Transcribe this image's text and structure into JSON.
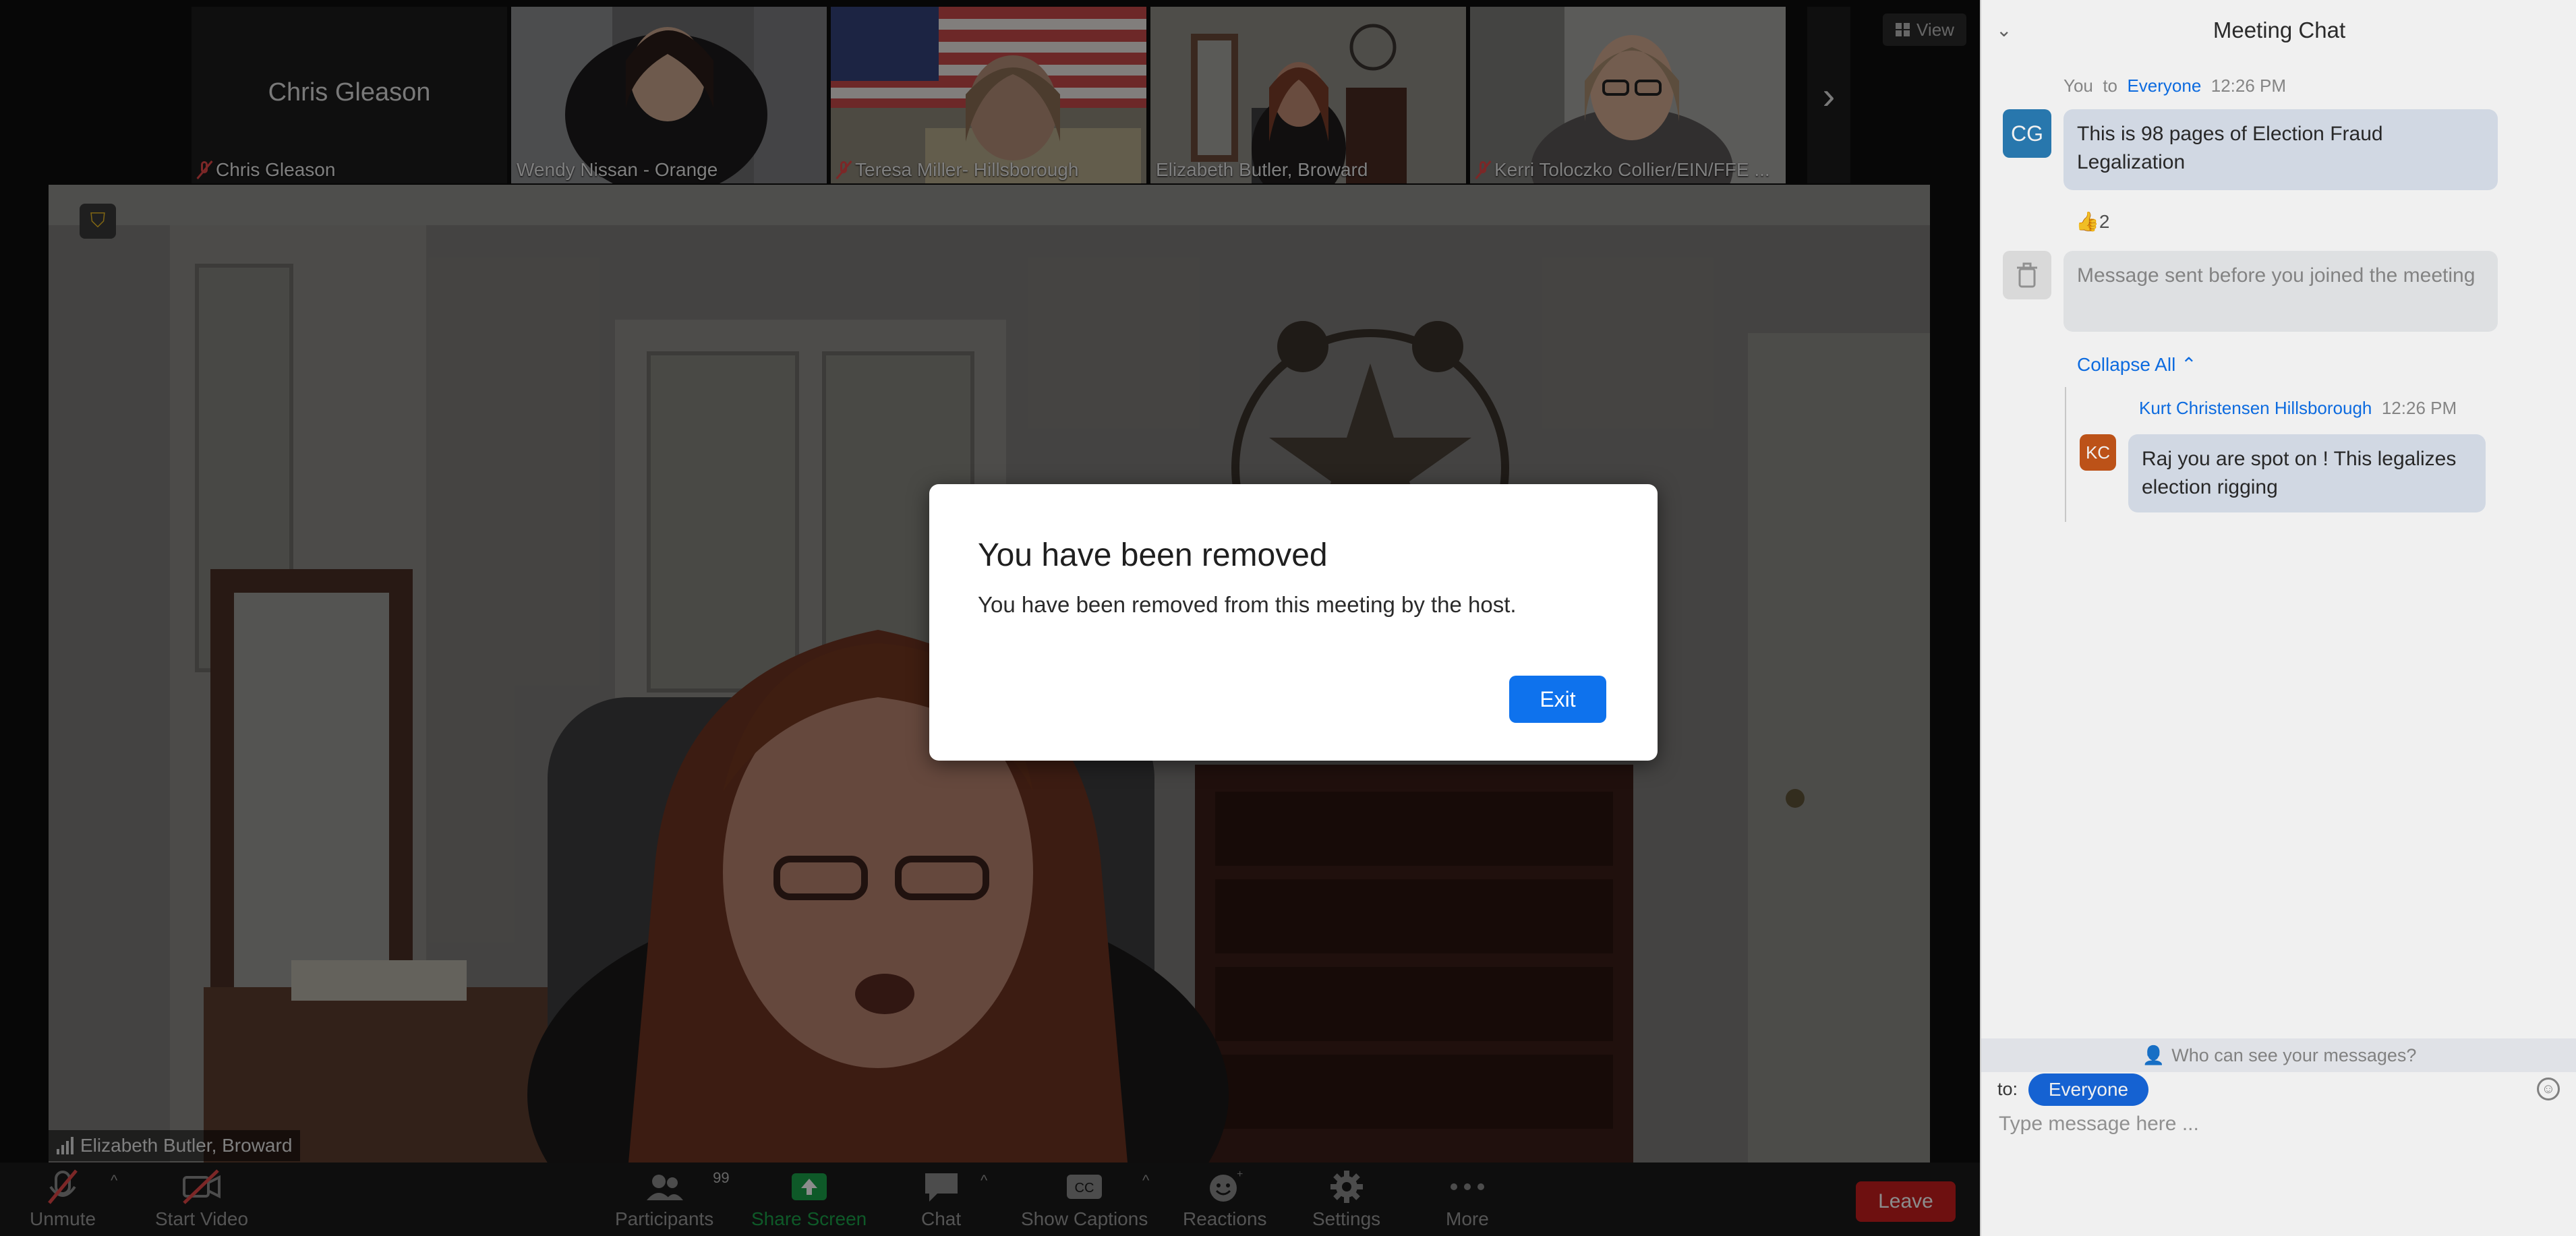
{
  "thumbnails": [
    {
      "name": "Chris Gleason",
      "big_label": "Chris Gleason",
      "muted": true
    },
    {
      "name": "Wendy Nissan - Orange",
      "muted": false
    },
    {
      "name": "Teresa Miller- Hillsborough",
      "muted": true
    },
    {
      "name": "Elizabeth Butler, Broward",
      "muted": false,
      "active": true
    },
    {
      "name": "Kerri Toloczko Collier/EIN/FFE ...",
      "muted": true
    }
  ],
  "view_button": "View",
  "main_video": {
    "name": "Elizabeth Butler, Broward"
  },
  "modal": {
    "title": "You have been removed",
    "body": "You have been removed from this meeting by the host.",
    "exit_label": "Exit"
  },
  "toolbar": {
    "unmute": "Unmute",
    "start_video": "Start Video",
    "participants": "Participants",
    "participants_count": "99",
    "share_screen": "Share Screen",
    "chat": "Chat",
    "show_captions": "Show Captions",
    "reactions": "Reactions",
    "settings": "Settings",
    "more": "More",
    "leave": "Leave"
  },
  "chat": {
    "title": "Meeting Chat",
    "messages": [
      {
        "sender": "You",
        "to_word": "to",
        "recipient": "Everyone",
        "time": "12:26 PM",
        "avatar": "CG",
        "avatar_color": "#2b7fb8",
        "text": "This is 98 pages of Election Fraud Legalization",
        "reaction": "👍2"
      },
      {
        "text": "Message sent before you joined the meeting"
      },
      {
        "collapse_label": "Collapse All"
      },
      {
        "sender": "Kurt Christensen Hillsborough",
        "time": "12:26 PM",
        "avatar": "KC",
        "avatar_color": "#c8581a",
        "text": "Raj you are spot on ! This legalizes election rigging"
      }
    ],
    "visibility_label": "Who can see your messages?",
    "to_label": "to:",
    "to_target": "Everyone",
    "input_placeholder": "Type message here ..."
  },
  "colors": {
    "accent": "#0e72ed",
    "leave": "#c81e1e",
    "share": "#1aa34a",
    "muted": "#e24848"
  }
}
